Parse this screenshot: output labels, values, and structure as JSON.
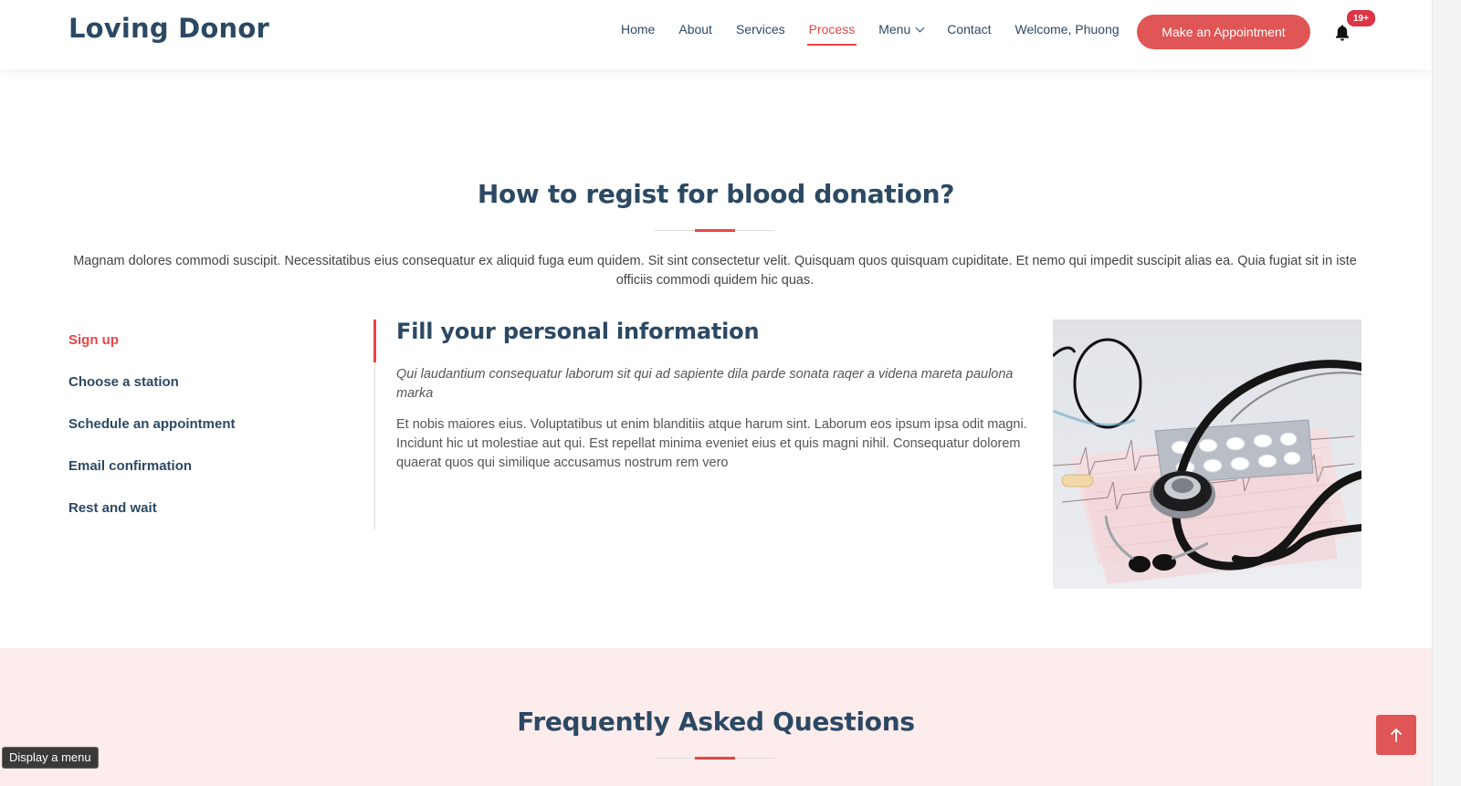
{
  "brand": {
    "logo": "Loving Donor",
    "accent_color": "#e84545",
    "text_color": "#2c4964"
  },
  "nav": {
    "items": [
      {
        "label": "Home"
      },
      {
        "label": "About"
      },
      {
        "label": "Services"
      },
      {
        "label": "Process",
        "active": true
      },
      {
        "label": "Menu",
        "has_dropdown": true
      },
      {
        "label": "Contact"
      },
      {
        "label": "Welcome, Phuong"
      }
    ],
    "cta_label": "Make an Appointment",
    "notification_icon": "bell-icon",
    "notification_count": "19+"
  },
  "process": {
    "title": "How to regist for blood donation?",
    "description": "Magnam dolores commodi suscipit. Necessitatibus eius consequatur ex aliquid fuga eum quidem. Sit sint consectetur velit. Quisquam quos quisquam cupiditate. Et nemo qui impedit suscipit alias ea. Quia fugiat sit in iste officiis commodi quidem hic quas.",
    "tabs": [
      {
        "label": "Sign up",
        "active": true
      },
      {
        "label": "Choose a station"
      },
      {
        "label": "Schedule an appointment"
      },
      {
        "label": "Email confirmation"
      },
      {
        "label": "Rest and wait"
      }
    ],
    "pane": {
      "title": "Fill your personal information",
      "italic": "Qui laudantium consequatur laborum sit qui ad sapiente dila parde sonata raqer a videna mareta paulona marka",
      "body": "Et nobis maiores eius. Voluptatibus ut enim blanditiis atque harum sint. Laborum eos ipsum ipsa odit magni. Incidunt hic ut molestiae aut qui. Est repellat minima eveniet eius et quis magni nihil. Consequatur dolorem quaerat quos qui similique accusamus nostrum rem vero",
      "image": "stethoscope-glasses-ecg-photo"
    }
  },
  "faq": {
    "title": "Frequently Asked Questions"
  },
  "back_to_top_icon": "arrow-up-icon",
  "tooltip": "Display a menu"
}
